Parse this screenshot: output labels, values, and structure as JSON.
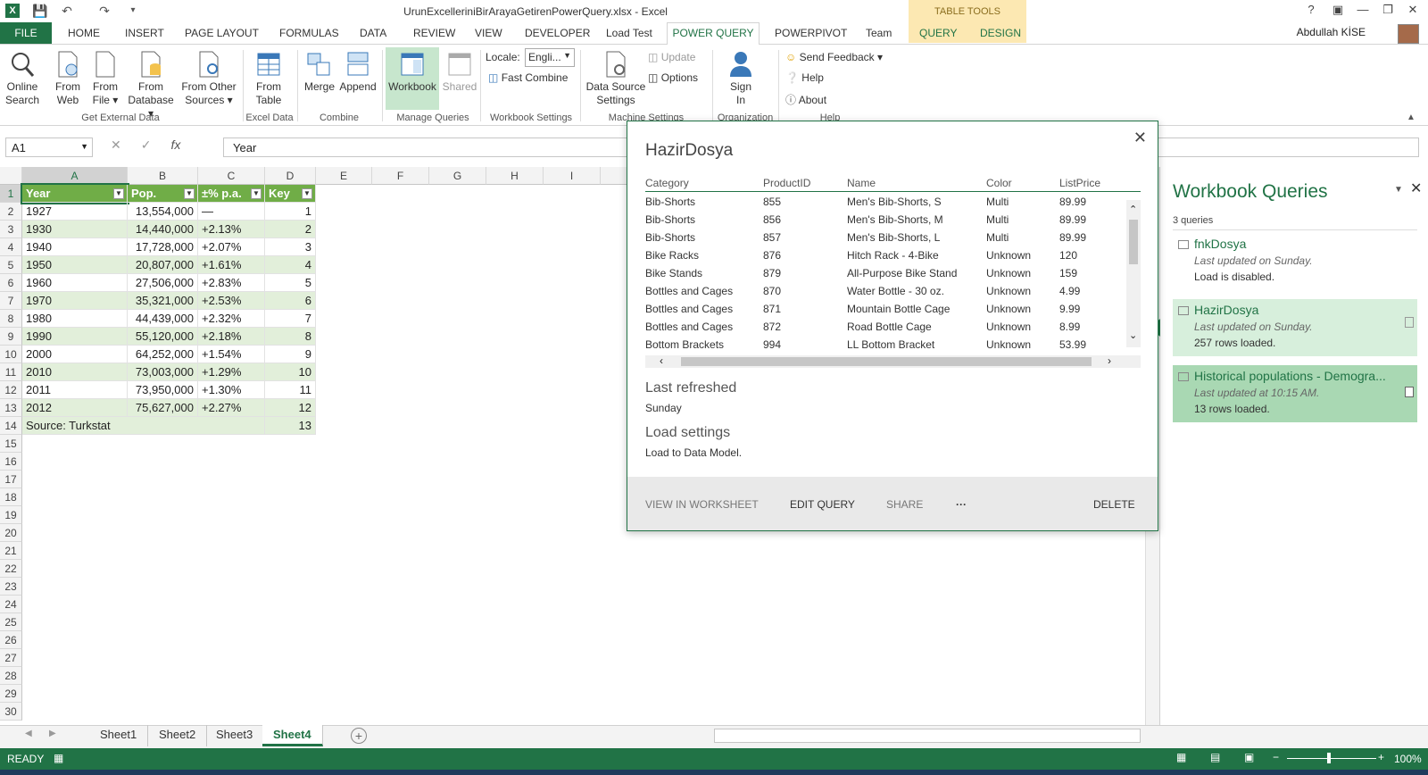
{
  "title": "UrunExcelleriniBirArayaGetirenPowerQuery.xlsx - Excel",
  "table_tools": "TABLE TOOLS",
  "user": "Abdullah KİSE",
  "tabs": {
    "file": "FILE",
    "home": "HOME",
    "insert": "INSERT",
    "page_layout": "PAGE LAYOUT",
    "formulas": "FORMULAS",
    "data": "DATA",
    "review": "REVIEW",
    "view": "VIEW",
    "developer": "DEVELOPER",
    "load_test": "Load Test",
    "power_query": "POWER QUERY",
    "powerpivot": "POWERPIVOT",
    "team": "Team",
    "query": "QUERY",
    "design": "DESIGN"
  },
  "ribbon": {
    "online_search": [
      "Online",
      "Search"
    ],
    "from_web": [
      "From",
      "Web"
    ],
    "from_file": [
      "From",
      "File ▾"
    ],
    "from_database": [
      "From",
      "Database ▾"
    ],
    "from_other": [
      "From Other",
      "Sources ▾"
    ],
    "from_table": [
      "From",
      "Table"
    ],
    "merge": "Merge",
    "append": "Append",
    "workbook": "Workbook",
    "shared": "Shared",
    "locale_label": "Locale:",
    "locale_value": "Engli...",
    "fast_combine": "Fast Combine",
    "update": "Update",
    "options": "Options",
    "data_source": [
      "Data Source",
      "Settings"
    ],
    "sign_in": [
      "Sign",
      "In"
    ],
    "send_feedback": "Send Feedback ▾",
    "help": "Help",
    "about": "About",
    "groups": {
      "get_external": "Get External Data",
      "excel_data": "Excel Data",
      "combine": "Combine",
      "manage": "Manage Queries",
      "wb_settings": "Workbook Settings",
      "machine": "Machine Settings",
      "org": "Organization",
      "help": "Help"
    }
  },
  "namebox": "A1",
  "formula": "Year",
  "columns": [
    "A",
    "B",
    "C",
    "D",
    "E",
    "F",
    "G",
    "H",
    "I"
  ],
  "table": {
    "headers": [
      "Year",
      "Pop.",
      "±% p.a.",
      "Key"
    ],
    "rows": [
      [
        "1927",
        "13,554,000",
        "—",
        "1"
      ],
      [
        "1930",
        "14,440,000",
        "+2.13%",
        "2"
      ],
      [
        "1940",
        "17,728,000",
        "+2.07%",
        "3"
      ],
      [
        "1950",
        "20,807,000",
        "+1.61%",
        "4"
      ],
      [
        "1960",
        "27,506,000",
        "+2.83%",
        "5"
      ],
      [
        "1970",
        "35,321,000",
        "+2.53%",
        "6"
      ],
      [
        "1980",
        "44,439,000",
        "+2.32%",
        "7"
      ],
      [
        "1990",
        "55,120,000",
        "+2.18%",
        "8"
      ],
      [
        "2000",
        "64,252,000",
        "+1.54%",
        "9"
      ],
      [
        "2010",
        "73,003,000",
        "+1.29%",
        "10"
      ],
      [
        "2011",
        "73,950,000",
        "+1.30%",
        "11"
      ],
      [
        "2012",
        "75,627,000",
        "+2.27%",
        "12"
      ]
    ],
    "footer": [
      "Source: Turkstat",
      "13"
    ]
  },
  "row_numbers": [
    "1",
    "2",
    "3",
    "4",
    "5",
    "6",
    "7",
    "8",
    "9",
    "10",
    "11",
    "12",
    "13",
    "14",
    "15",
    "16",
    "17",
    "18",
    "19",
    "20",
    "21",
    "22",
    "23",
    "24",
    "25",
    "26",
    "27",
    "28",
    "29",
    "30"
  ],
  "sheets": [
    "Sheet1",
    "Sheet2",
    "Sheet3",
    "Sheet4"
  ],
  "active_sheet": "Sheet4",
  "status": {
    "ready": "READY",
    "zoom": "100%"
  },
  "popup": {
    "title": "HazirDosya",
    "headers": [
      "Category",
      "ProductID",
      "Name",
      "Color",
      "ListPrice"
    ],
    "rows": [
      [
        "Bib-Shorts",
        "855",
        "Men's Bib-Shorts, S",
        "Multi",
        "89.99"
      ],
      [
        "Bib-Shorts",
        "856",
        "Men's Bib-Shorts, M",
        "Multi",
        "89.99"
      ],
      [
        "Bib-Shorts",
        "857",
        "Men's Bib-Shorts, L",
        "Multi",
        "89.99"
      ],
      [
        "Bike Racks",
        "876",
        "Hitch Rack - 4-Bike",
        "Unknown",
        "120"
      ],
      [
        "Bike Stands",
        "879",
        "All-Purpose Bike Stand",
        "Unknown",
        "159"
      ],
      [
        "Bottles and Cages",
        "870",
        "Water Bottle - 30 oz.",
        "Unknown",
        "4.99"
      ],
      [
        "Bottles and Cages",
        "871",
        "Mountain Bottle Cage",
        "Unknown",
        "9.99"
      ],
      [
        "Bottles and Cages",
        "872",
        "Road Bottle Cage",
        "Unknown",
        "8.99"
      ],
      [
        "Bottom Brackets",
        "994",
        "LL Bottom Bracket",
        "Unknown",
        "53.99"
      ]
    ],
    "last_refreshed_label": "Last refreshed",
    "last_refreshed_value": "Sunday",
    "load_settings_label": "Load settings",
    "load_settings_value": "Load to Data Model.",
    "actions": {
      "view": "VIEW IN WORKSHEET",
      "edit": "EDIT QUERY",
      "share": "SHARE",
      "more": "···",
      "delete": "DELETE"
    }
  },
  "pane": {
    "title": "Workbook Queries",
    "count": "3 queries",
    "queries": [
      {
        "name": "fnkDosya",
        "updated": "Last updated on Sunday.",
        "status": "Load is disabled."
      },
      {
        "name": "HazirDosya",
        "updated": "Last updated on Sunday.",
        "status": "257 rows loaded."
      },
      {
        "name": "Historical populations - Demogra...",
        "updated": "Last updated at 10:15 AM.",
        "status": "13 rows loaded."
      }
    ]
  },
  "colors": {
    "excel_green": "#217346",
    "table_header": "#70ad47",
    "band": "#e2efda",
    "selected_query": "#d7efdc",
    "hover_query": "#a9d8b3"
  }
}
